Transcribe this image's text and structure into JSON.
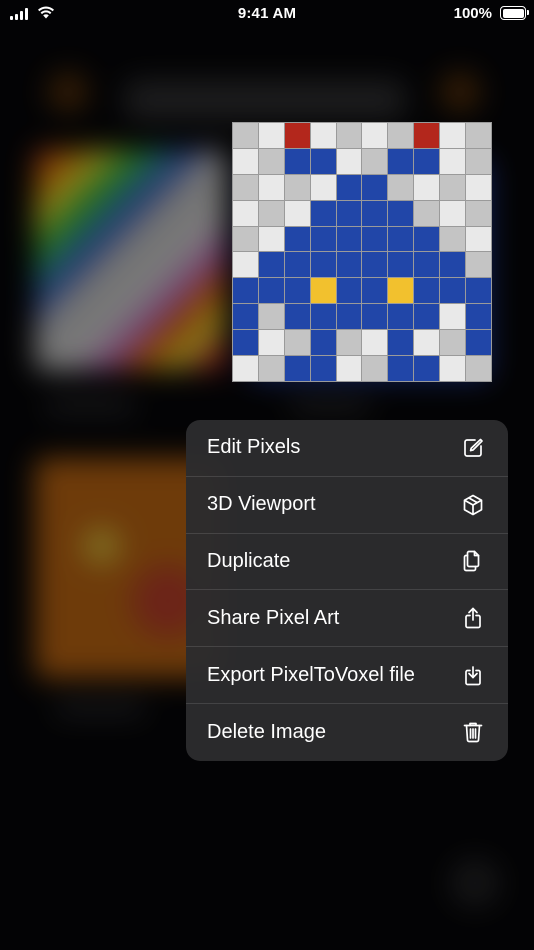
{
  "status_bar": {
    "time": "9:41 AM",
    "battery_percent": "100%",
    "battery_level": 1.0,
    "signal_bars": 4
  },
  "preview": {
    "palette": {
      "L": "#e9e9e9",
      "G": "#c4c4c4",
      "B": "#2146a8",
      "R": "#b3271c",
      "Y": "#f2c12e"
    },
    "grid": [
      "GLRLGLGRLG",
      "LGBBLGBBLG",
      "GLGLBBGLGL",
      "LGLBBBBGLG",
      "GLBBBBBBGL",
      "LBBBBBBBBG",
      "BBBYBBYBBB",
      "BGBBBBBBLB",
      "BLGBGLBLGB",
      "LGBBLGBBLG"
    ]
  },
  "context_menu": {
    "items": [
      {
        "label": "Edit Pixels",
        "icon": "square-and-pencil-icon",
        "name": "edit-pixels-item",
        "color": "#ffffff"
      },
      {
        "label": "3D Viewport",
        "icon": "cube-icon",
        "name": "3d-viewport-item",
        "color": "#ffffff"
      },
      {
        "label": "Duplicate",
        "icon": "duplicate-documents-icon",
        "name": "duplicate-item",
        "color": "#ffffff"
      },
      {
        "label": "Share Pixel Art",
        "icon": "share-icon",
        "name": "share-pixel-art-item",
        "color": "#ffffff"
      },
      {
        "label": "Export PixelToVoxel file",
        "icon": "export-download-icon",
        "name": "export-pixeltovoxel-item",
        "color": "#ffffff"
      },
      {
        "label": "Delete Image",
        "icon": "trash-icon",
        "name": "delete-image-item",
        "color": "#ffffff"
      }
    ]
  }
}
